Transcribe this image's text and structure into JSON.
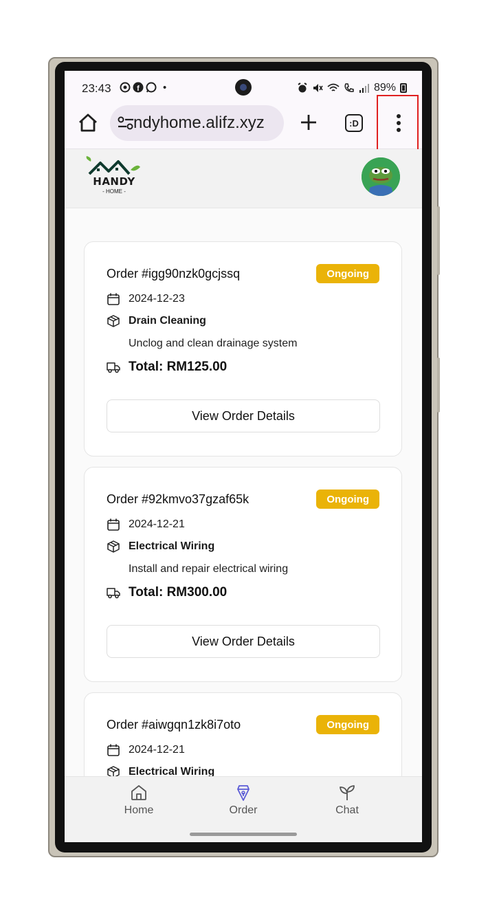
{
  "status_bar": {
    "time": "23:43",
    "left_icons": [
      "chrome-icon",
      "facebook-icon",
      "whatsapp-icon",
      "dot"
    ],
    "dot": "•",
    "battery_text": "89%"
  },
  "browser": {
    "url": "ndyhome.alifz.xyz",
    "tab_label": ":D"
  },
  "app": {
    "logo_text": "HANDY",
    "logo_sub": "- HOME -"
  },
  "orders": [
    {
      "title": "Order #igg90nzk0gcjssq",
      "status": "Ongoing",
      "date": "2024-12-23",
      "service": "Drain Cleaning",
      "description": "Unclog and clean drainage system",
      "total": "Total: RM125.00",
      "button": "View Order Details"
    },
    {
      "title": "Order #92kmvo37gzaf65k",
      "status": "Ongoing",
      "date": "2024-12-21",
      "service": "Electrical Wiring",
      "description": "Install and repair electrical wiring",
      "total": "Total: RM300.00",
      "button": "View Order Details"
    },
    {
      "title": "Order #aiwgqn1zk8i7oto",
      "status": "Ongoing",
      "date": "2024-12-21",
      "service": "Electrical Wiring"
    }
  ],
  "nav": {
    "home": "Home",
    "order": "Order",
    "chat": "Chat"
  },
  "colors": {
    "badge": "#eab308",
    "active_nav": "#5b5bd6",
    "highlight": "#e02020"
  }
}
